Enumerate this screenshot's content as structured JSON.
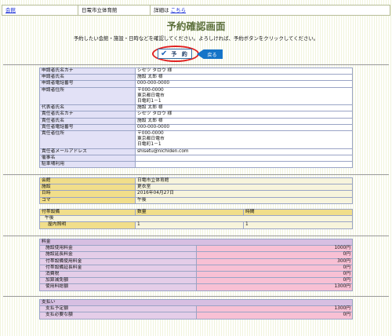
{
  "header": {
    "link": "会館",
    "facility": "日電市立体育館",
    "detail_prefix": "詳細は",
    "detail_link": "こちら"
  },
  "page_title": "予約確認画面",
  "message": "予約したい会館・施設・日時などを確認してください。よろしければ、予約ボタンをクリックしてください。",
  "buttons": {
    "reserve": "予 約",
    "back": "戻る"
  },
  "applicant": [
    {
      "label": "申請者氏名カナ",
      "value": "シセツ タロウ 様"
    },
    {
      "label": "申請者氏名",
      "value": "施設 太郎 様"
    },
    {
      "label": "申請者電話番号",
      "value": "000-000-0000"
    },
    {
      "label": "申請者住所",
      "value": "〒000-0000\n東京都日電市\n日電町1－1"
    },
    {
      "label": "代表者氏名",
      "value": "施設 太郎 様"
    },
    {
      "label": "責任者氏名カナ",
      "value": "シセツ タロウ 様"
    },
    {
      "label": "責任者氏名",
      "value": "施設 太郎 様"
    },
    {
      "label": "責任者電話番号",
      "value": "000-000-0000"
    },
    {
      "label": "責任者住所",
      "value": "〒000-0000\n東京都日電市\n日電町1－1"
    },
    {
      "label": "責任者メールアドレス",
      "value": "shisetu@nichiden.com"
    },
    {
      "label": "催事名",
      "value": ""
    },
    {
      "label": "駐車場利用",
      "value": ""
    }
  ],
  "reservation": [
    {
      "label": "会館",
      "value": "日電市立体育館"
    },
    {
      "label": "施設",
      "value": "更衣室"
    },
    {
      "label": "日時",
      "value": "2016年04月27日"
    },
    {
      "label": "コマ",
      "value": "午後"
    }
  ],
  "equipment": {
    "headers": [
      "付帯設備",
      "数量",
      "時間"
    ],
    "group": "午後",
    "row": {
      "name": "屋内照明",
      "qty": "1",
      "time": "1"
    }
  },
  "fees": {
    "title": "料金",
    "rows": [
      {
        "label": "施設使用料金",
        "value": "1000円"
      },
      {
        "label": "施設延長料金",
        "value": "0円"
      },
      {
        "label": "付帯設備使用料金",
        "value": "300円"
      },
      {
        "label": "付帯設備延長料金",
        "value": "0円"
      },
      {
        "label": "消費税",
        "value": "0円"
      },
      {
        "label": "加算減免額",
        "value": "0円"
      },
      {
        "label": "使用料総額",
        "value": "1300円"
      }
    ]
  },
  "payment": {
    "title": "支払い",
    "rows": [
      {
        "label": "支払予定額",
        "value": "1300円"
      },
      {
        "label": "支払必要な額",
        "value": "0円"
      }
    ]
  }
}
